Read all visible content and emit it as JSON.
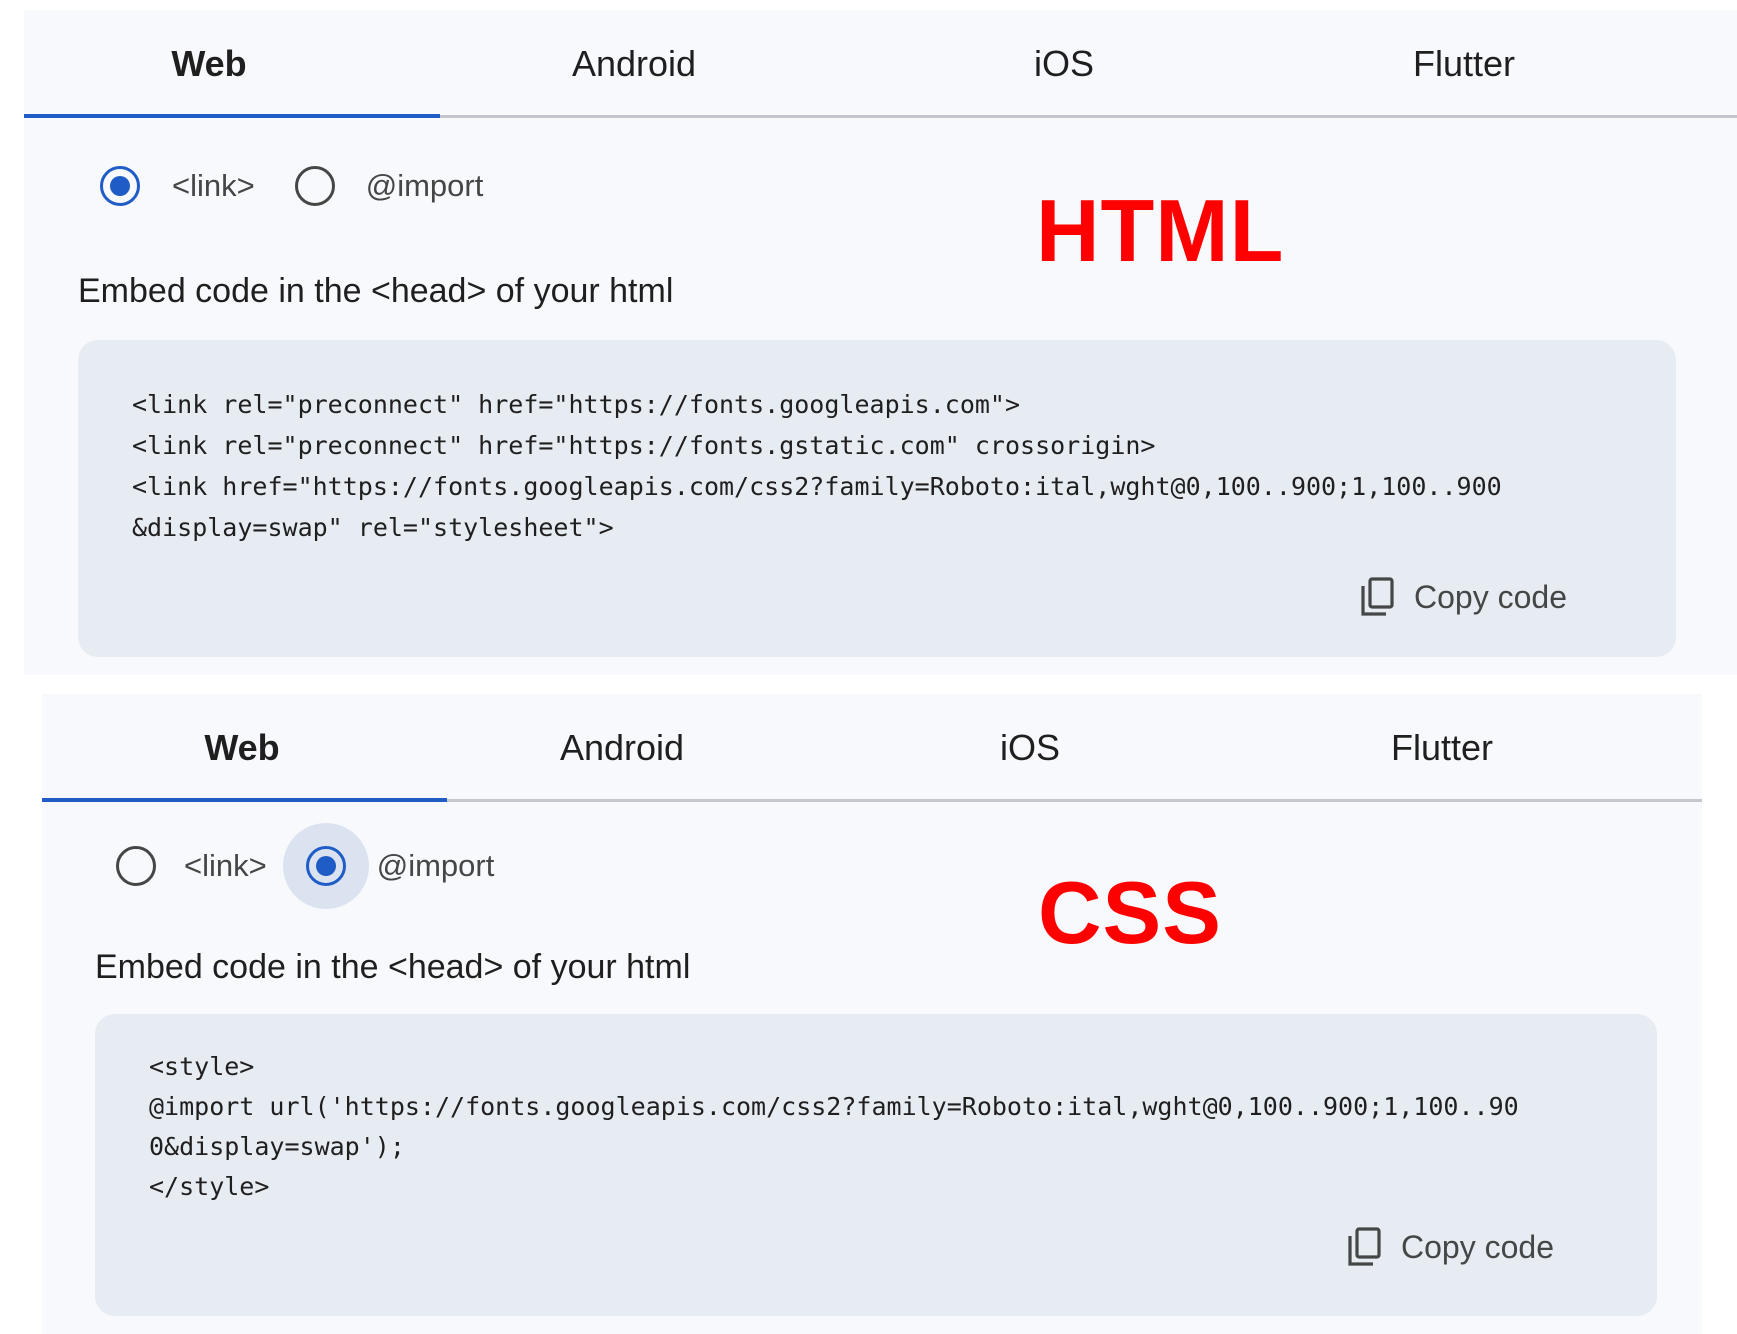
{
  "colors": {
    "accent": "#1f5cc6",
    "overlay_label": "#ff0000",
    "code_background": "#e7ebf2",
    "panel_background": "#f8f9fc"
  },
  "panels": [
    {
      "tabs": [
        {
          "label": "Web",
          "active": true
        },
        {
          "label": "Android",
          "active": false
        },
        {
          "label": "iOS",
          "active": false
        },
        {
          "label": "Flutter",
          "active": false
        }
      ],
      "options": [
        {
          "label": "<link>",
          "checked": true
        },
        {
          "label": "@import",
          "checked": false
        }
      ],
      "overlay_label": "HTML",
      "embed_title": "Embed code in the <head> of your html",
      "code_lines": [
        "<link rel=\"preconnect\" href=\"https://fonts.googleapis.com\">",
        "<link rel=\"preconnect\" href=\"https://fonts.gstatic.com\" crossorigin>",
        "<link href=\"https://fonts.googleapis.com/css2?family=Roboto:ital,wght@0,100..900;1,100..900",
        "&display=swap\" rel=\"stylesheet\">"
      ],
      "copy_label": "Copy code",
      "copy_icon": "copy-icon"
    },
    {
      "tabs": [
        {
          "label": "Web",
          "active": true
        },
        {
          "label": "Android",
          "active": false
        },
        {
          "label": "iOS",
          "active": false
        },
        {
          "label": "Flutter",
          "active": false
        }
      ],
      "options": [
        {
          "label": "<link>",
          "checked": false
        },
        {
          "label": "@import",
          "checked": true
        }
      ],
      "overlay_label": "CSS",
      "embed_title": "Embed code in the <head> of your html",
      "code_lines": [
        "<style>",
        "@import url('https://fonts.googleapis.com/css2?family=Roboto:ital,wght@0,100..900;1,100..90",
        "0&display=swap');",
        "</style>"
      ],
      "copy_label": "Copy code",
      "copy_icon": "copy-icon"
    }
  ]
}
